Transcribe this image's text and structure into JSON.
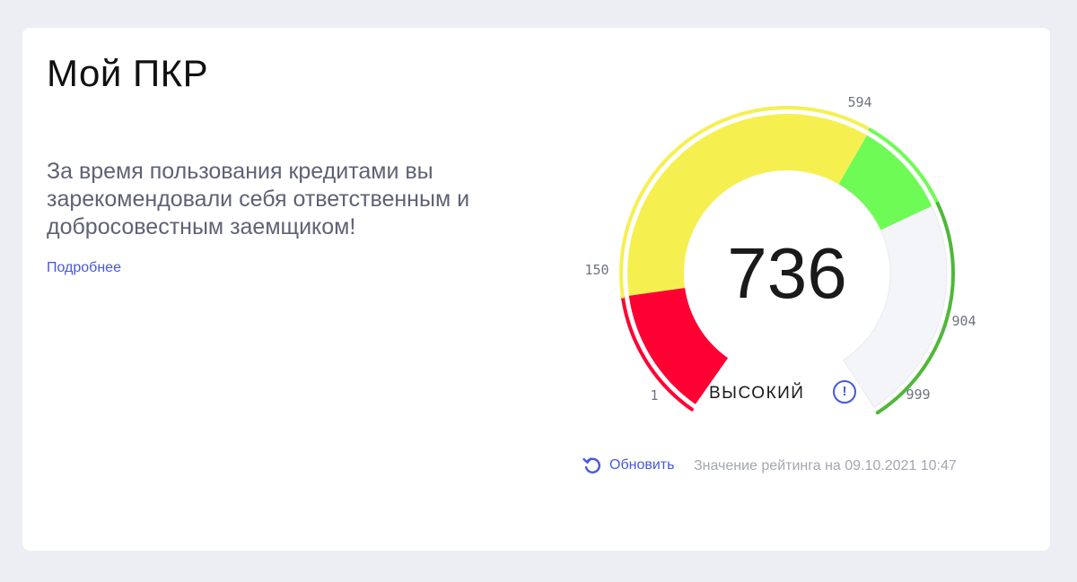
{
  "card": {
    "title": "Мой ПКР",
    "description": "За время пользования кредитами вы зарекомендовали себя ответственным и добросовестным заемщиком!",
    "more_link": "Подробнее"
  },
  "gauge": {
    "score": "736",
    "score_value": 736,
    "min": 1,
    "max": 999,
    "level_label": "ВЫСОКИЙ",
    "info_icon": "info-icon",
    "ticks": [
      "1",
      "150",
      "594",
      "904",
      "999"
    ],
    "zones": [
      {
        "name": "low",
        "from": 1,
        "to": 150,
        "color": "#ff0033"
      },
      {
        "name": "medium",
        "from": 150,
        "to": 594,
        "color": "#f5f050"
      },
      {
        "name": "high",
        "from": 594,
        "to": 904,
        "color": "#6ffb55"
      },
      {
        "name": "top",
        "from": 904,
        "to": 999,
        "color": "#f4f5f8"
      }
    ],
    "outer_arc_colors": {
      "red": "#ff0033",
      "yellow": "#f5f050",
      "green": "#6ffb55",
      "dark_green": "#4fb83a"
    }
  },
  "footer": {
    "refresh_icon": "refresh-icon",
    "refresh_label": "Обновить",
    "rating_date": "Значение рейтинга на 09.10.2021 10:47"
  },
  "colors": {
    "accent": "#4658e0",
    "background": "#eceef4",
    "card": "#ffffff"
  }
}
